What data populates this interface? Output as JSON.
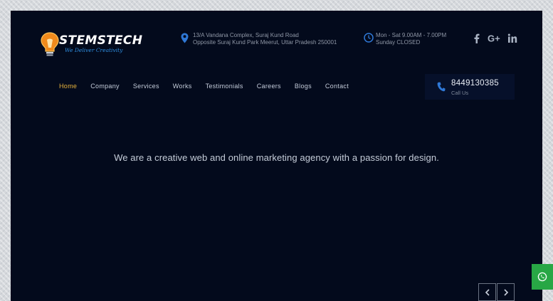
{
  "brand": {
    "name": "STEMSTECH",
    "tagline": "We Deliver Creativity",
    "logo_icon": "lightbulb-icon",
    "accent_color": "#e8b33b",
    "brand_blue": "#2f8ee0"
  },
  "header": {
    "address_line1": "13/A Vandana Complex, Suraj Kund Road",
    "address_line2": "Opposite Suraj Kund Park Meerut, Uttar Pradesh 250001",
    "hours_line1": "Mon - Sat 9.00AM - 7.00PM",
    "hours_line2": "Sunday CLOSED",
    "social": [
      "facebook-icon",
      "google-plus-icon",
      "linkedin-icon"
    ]
  },
  "nav": {
    "items": [
      {
        "label": "Home",
        "active": true
      },
      {
        "label": "Company"
      },
      {
        "label": "Services"
      },
      {
        "label": "Works"
      },
      {
        "label": "Testimonials"
      },
      {
        "label": "Careers"
      },
      {
        "label": "Blogs"
      },
      {
        "label": "Contact"
      }
    ]
  },
  "call": {
    "number": "8449130385",
    "label": "Call Us"
  },
  "hero": {
    "tagline": "We are a creative web and online marketing agency with a passion for design."
  },
  "slider": {
    "prev_icon": "chevron-left-icon",
    "next_icon": "chevron-right-icon"
  },
  "floating": {
    "whatsapp_icon": "whatsapp-icon",
    "whatsapp_color": "#28a745"
  }
}
